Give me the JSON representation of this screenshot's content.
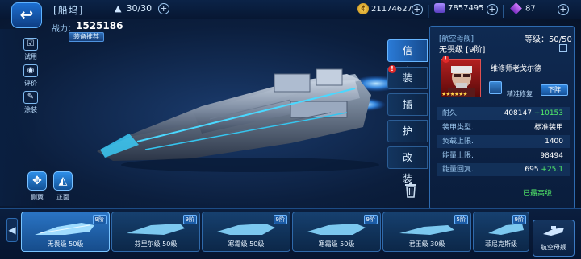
{
  "header": {
    "back_icon": "back-arrow-icon",
    "title": "[船坞]",
    "fleet_count": "30/30",
    "credits": "21174627",
    "cubes": "7857495",
    "gems": "87"
  },
  "power": {
    "label": "战力：",
    "value": "1525186",
    "recommend_label": "装备推荐"
  },
  "side_buttons": {
    "trial": "试用",
    "review": "评价",
    "paint": "涂装",
    "wings": "侧翼",
    "front": "正面"
  },
  "tabs": [
    "信 息",
    "装 备",
    "插 件",
    "护 盾",
    "改 装"
  ],
  "alert_mark": "!",
  "panel": {
    "category": "[航空母舰]",
    "level_label": "等级：",
    "level_value": "50/50",
    "ship_name": "无畏级 [9阶]",
    "officer_name": "维修师老戈尔德",
    "skill_label": "精准修复",
    "down_button": "下阵",
    "stars": "★★★★★★",
    "stats": [
      {
        "label": "耐久.",
        "value": "408147",
        "bonus": "+10153"
      },
      {
        "label": "装甲类型.",
        "value": "标准装甲",
        "bonus": ""
      },
      {
        "label": "负载上限.",
        "value": "1400",
        "bonus": ""
      },
      {
        "label": "能量上限.",
        "value": "98494",
        "bonus": ""
      },
      {
        "label": "能量回复.",
        "value": "695",
        "bonus": "+25.1"
      }
    ],
    "max_label": "已最高级"
  },
  "ship_list": [
    {
      "name": "无畏级 50级",
      "rank": "9阶",
      "selected": true
    },
    {
      "name": "芬里尔级 50级",
      "rank": "9阶",
      "selected": false
    },
    {
      "name": "寒霜级 50级",
      "rank": "9阶",
      "selected": false
    },
    {
      "name": "寒霜级 50级",
      "rank": "9阶",
      "selected": false
    },
    {
      "name": "君王级 30级",
      "rank": "5阶",
      "selected": false
    },
    {
      "name": "菲尼克斯级",
      "rank": "9阶",
      "selected": false
    }
  ],
  "carrier_button": "航空母舰",
  "colors": {
    "accent": "#2a7ad6",
    "positive": "#54f06a",
    "warning": "#e02a2a",
    "gold": "#ffd24a"
  }
}
